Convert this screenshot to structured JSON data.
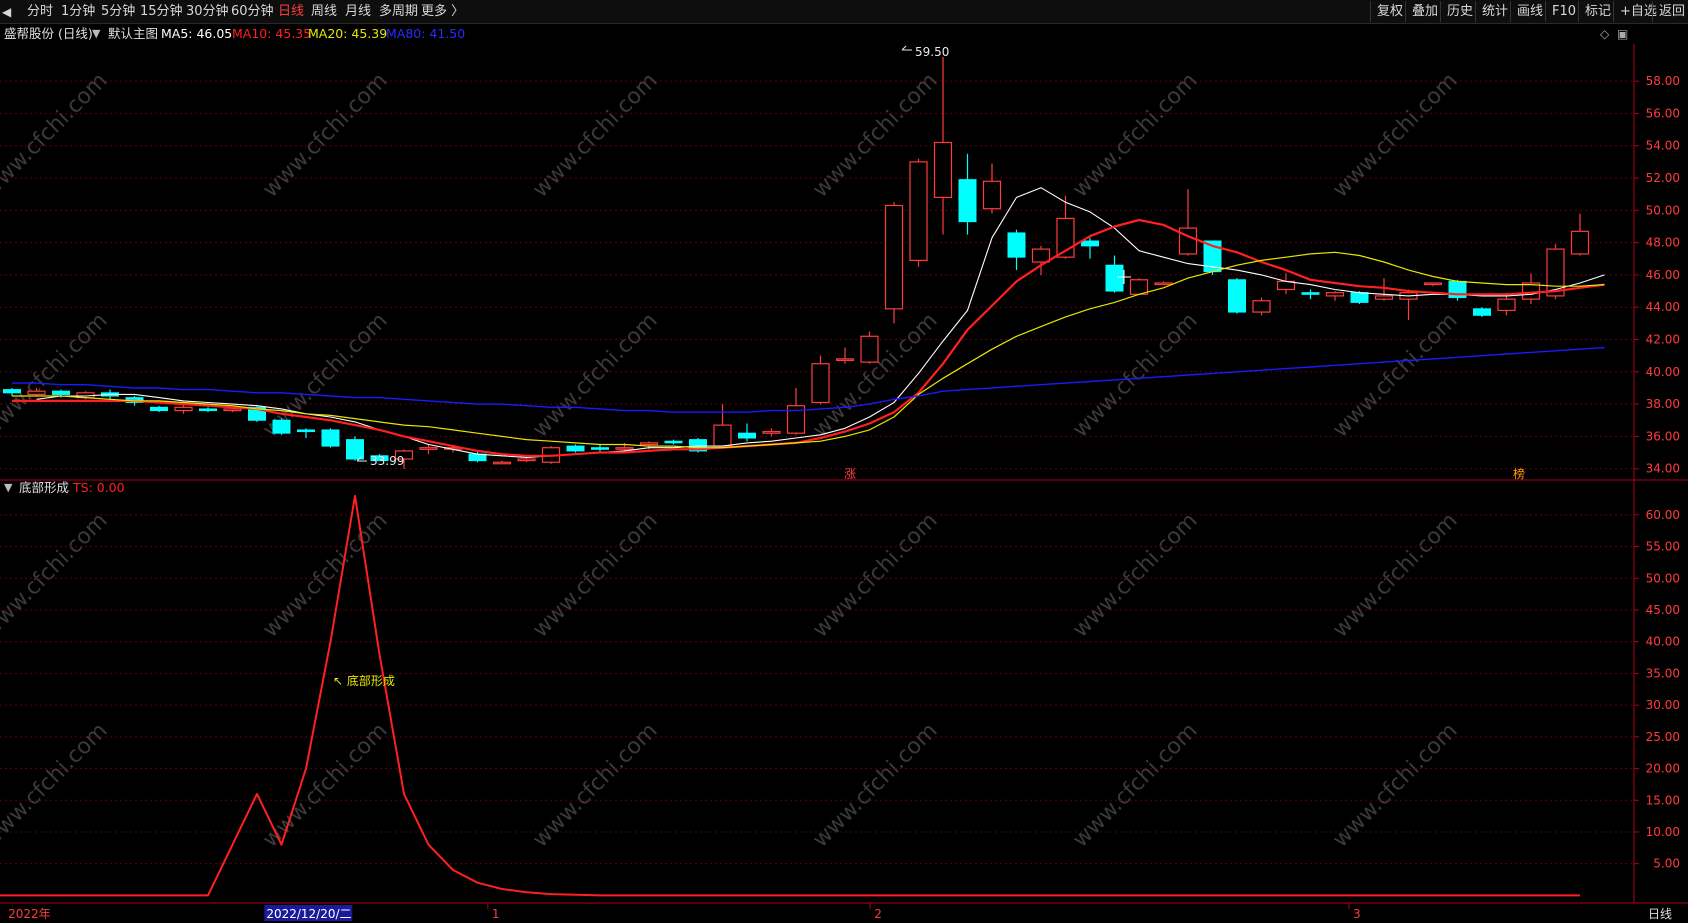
{
  "toolbar": {
    "menu_icon": "menu-icon",
    "periods": [
      "分时",
      "1分钟",
      "5分钟",
      "15分钟",
      "30分钟",
      "60分钟",
      "日线",
      "周线",
      "月线",
      "多周期",
      "更多 〉"
    ],
    "active_period": "日线",
    "right_buttons": [
      "复权",
      "叠加",
      "历史",
      "统计",
      "画线",
      "F10",
      "标记",
      "+自选",
      "返回"
    ]
  },
  "main_header": {
    "stock": "盛帮股份 (日线)",
    "indicator_name": "默认主图",
    "ma5": "MA5: 46.05",
    "ma10": "MA10: 45.35",
    "ma20": "MA20: 45.39",
    "ma80": "MA80: 41.50"
  },
  "sub_header": {
    "indicator": "底部形成",
    "ts": "TS: 0.00"
  },
  "annotations": {
    "high_label": "59.50",
    "low_label": "33.99",
    "zhang_marker": "涨",
    "bang_marker": "榜",
    "bottom_label": "↖ 底部形成"
  },
  "x_axis": {
    "labels": [
      {
        "text": "2022年",
        "pos": 0.005
      },
      {
        "text": "2022/12/20/二",
        "pos": 0.163
      },
      {
        "text": "1",
        "pos": 0.301
      },
      {
        "text": "2",
        "pos": 0.535
      },
      {
        "text": "3",
        "pos": 0.828
      }
    ],
    "period_label": "日线"
  },
  "watermark": "www.cfchi.com",
  "colors": {
    "up": "#ff3c3c",
    "down": "#00ffff",
    "ma5": "#ffffff",
    "ma10": "#ff2020",
    "ma20": "#e6e600",
    "ma80": "#1a1aff",
    "indicator": "#ff2020",
    "active_period": "#ff3c3c"
  },
  "chart_data": [
    {
      "type": "candlestick",
      "title": "盛帮股份 (日线)",
      "y_ticks": [
        34,
        36,
        38,
        40,
        42,
        44,
        46,
        48,
        50,
        52,
        54,
        56,
        58
      ],
      "ylim": [
        33.3,
        60.3
      ],
      "candles": [
        [
          38.9,
          38.7,
          39.0,
          38.5
        ],
        [
          38.6,
          38.8,
          39.0,
          38.5
        ],
        [
          38.8,
          38.6,
          38.9,
          38.4
        ],
        [
          38.4,
          38.7,
          38.8,
          38.3
        ],
        [
          38.7,
          38.5,
          38.9,
          38.2
        ],
        [
          38.4,
          38.1,
          38.5,
          37.9
        ],
        [
          37.8,
          37.6,
          37.9,
          37.5
        ],
        [
          37.6,
          37.8,
          38.0,
          37.4
        ],
        [
          37.7,
          37.6,
          37.8,
          37.5
        ],
        [
          37.6,
          37.7,
          37.8,
          37.5
        ],
        [
          37.8,
          37.0,
          37.9,
          36.9
        ],
        [
          37.0,
          36.2,
          37.1,
          36.1
        ],
        [
          36.4,
          36.3,
          36.5,
          35.9
        ],
        [
          36.4,
          35.4,
          36.5,
          35.3
        ],
        [
          35.8,
          34.6,
          36.0,
          34.5
        ],
        [
          34.8,
          34.5,
          34.9,
          34.5
        ],
        [
          34.6,
          35.1,
          35.2,
          33.99
        ],
        [
          35.2,
          35.3,
          35.5,
          34.9
        ],
        [
          35.3,
          35.3,
          35.4,
          35.0
        ],
        [
          34.9,
          34.5,
          35.1,
          34.4
        ],
        [
          34.4,
          34.4,
          34.5,
          34.3
        ],
        [
          34.5,
          34.6,
          34.7,
          34.4
        ],
        [
          34.4,
          35.3,
          35.4,
          34.3
        ],
        [
          35.4,
          35.1,
          35.5,
          35.0
        ],
        [
          35.3,
          35.2,
          35.5,
          35.0
        ],
        [
          35.3,
          35.3,
          35.6,
          35.1
        ],
        [
          35.5,
          35.6,
          35.7,
          35.2
        ],
        [
          35.7,
          35.6,
          35.8,
          35.5
        ],
        [
          35.8,
          35.1,
          35.9,
          35.0
        ],
        [
          35.4,
          36.7,
          38.0,
          35.3
        ],
        [
          36.2,
          35.9,
          36.8,
          35.7
        ],
        [
          36.2,
          36.3,
          36.5,
          36.0
        ],
        [
          36.2,
          37.9,
          39.0,
          36.1
        ],
        [
          38.1,
          40.5,
          41.0,
          38.0
        ],
        [
          40.8,
          40.8,
          41.5,
          40.5
        ],
        [
          40.6,
          42.2,
          42.5,
          40.5
        ],
        [
          43.9,
          50.3,
          50.5,
          43.0
        ],
        [
          46.9,
          53.0,
          53.2,
          46.5
        ],
        [
          50.8,
          54.2,
          59.5,
          48.5
        ],
        [
          51.9,
          49.3,
          53.5,
          48.5
        ],
        [
          50.1,
          51.8,
          52.9,
          49.8
        ],
        [
          48.6,
          47.1,
          48.8,
          46.3
        ],
        [
          46.8,
          47.6,
          47.8,
          46.0
        ],
        [
          47.1,
          49.5,
          50.9,
          47.0
        ],
        [
          48.1,
          47.8,
          48.3,
          47.0
        ],
        [
          46.6,
          45.0,
          47.2,
          44.9
        ],
        [
          44.8,
          45.7,
          45.8,
          44.8
        ],
        [
          45.5,
          45.5,
          45.6,
          45.4
        ],
        [
          47.3,
          48.9,
          51.3,
          47.2
        ],
        [
          48.1,
          46.2,
          48.1,
          46.0
        ],
        [
          45.7,
          43.7,
          45.8,
          43.6
        ],
        [
          43.7,
          44.4,
          44.6,
          43.5
        ],
        [
          45.1,
          45.6,
          46.1,
          44.8
        ],
        [
          44.9,
          44.8,
          45.1,
          44.5
        ],
        [
          44.7,
          44.9,
          45.0,
          44.4
        ],
        [
          44.9,
          44.3,
          45.0,
          44.2
        ],
        [
          44.5,
          44.7,
          45.8,
          44.4
        ],
        [
          44.5,
          44.9,
          45.1,
          43.2
        ],
        [
          45.5,
          45.5,
          45.5,
          45.3
        ],
        [
          45.6,
          44.6,
          45.7,
          44.4
        ],
        [
          43.9,
          43.5,
          44.0,
          43.4
        ],
        [
          43.8,
          44.5,
          44.9,
          43.5
        ],
        [
          44.5,
          45.5,
          46.1,
          44.2
        ],
        [
          44.7,
          47.6,
          47.9,
          44.5
        ],
        [
          47.3,
          48.7,
          49.8,
          47.2
        ]
      ],
      "series": [
        {
          "name": "MA5",
          "start": 1,
          "values": [
            38.3,
            38.5,
            38.5,
            38.6,
            38.6,
            38.4,
            38.2,
            38.1,
            38.0,
            37.9,
            37.7,
            37.4,
            37.2,
            36.9,
            36.4,
            36.0,
            35.5,
            35.2,
            34.9,
            34.8,
            34.7,
            34.8,
            34.9,
            35.0,
            35.1,
            35.3,
            35.3,
            35.4,
            35.4,
            35.6,
            35.7,
            35.9,
            36.1,
            36.5,
            37.2,
            38.1,
            39.9,
            41.9,
            43.8,
            48.3,
            50.8,
            51.4,
            50.5,
            49.9,
            48.9,
            47.5,
            47.1,
            46.7,
            46.5,
            46.3,
            46.0,
            45.6,
            45.4,
            45.1,
            44.9,
            44.8,
            44.7,
            44.8,
            44.8,
            44.7,
            44.7,
            44.8,
            45.1,
            45.5,
            46.0
          ]
        },
        {
          "name": "MA10",
          "start": 0,
          "values": [
            38.2,
            38.2,
            38.2,
            38.2,
            38.2,
            38.2,
            38.1,
            38.0,
            37.9,
            37.8,
            37.7,
            37.4,
            37.2,
            37.0,
            36.7,
            36.4,
            36.0,
            35.7,
            35.4,
            35.1,
            34.9,
            34.8,
            34.8,
            34.9,
            35.0,
            35.0,
            35.1,
            35.2,
            35.2,
            35.3,
            35.4,
            35.5,
            35.6,
            35.9,
            36.3,
            36.8,
            37.5,
            38.7,
            40.5,
            42.6,
            44.1,
            45.6,
            46.6,
            47.5,
            48.4,
            49.0,
            49.4,
            49.1,
            48.4,
            47.8,
            47.4,
            46.8,
            46.3,
            45.7,
            45.5,
            45.3,
            45.2,
            45.0,
            44.9,
            44.8,
            44.8,
            44.8,
            44.9,
            45.0,
            45.2,
            45.4
          ]
        },
        {
          "name": "MA20",
          "start": 0,
          "values": [
            38.5,
            38.5,
            38.5,
            38.4,
            38.3,
            38.2,
            38.2,
            38.1,
            38.0,
            37.9,
            37.7,
            37.6,
            37.4,
            37.3,
            37.1,
            36.9,
            36.7,
            36.6,
            36.4,
            36.2,
            36.0,
            35.8,
            35.7,
            35.6,
            35.5,
            35.5,
            35.4,
            35.4,
            35.3,
            35.3,
            35.4,
            35.5,
            35.6,
            35.7,
            36.0,
            36.4,
            37.2,
            38.6,
            39.6,
            40.5,
            41.4,
            42.2,
            42.8,
            43.4,
            43.9,
            44.3,
            44.8,
            45.2,
            45.8,
            46.2,
            46.6,
            46.9,
            47.1,
            47.3,
            47.4,
            47.2,
            46.8,
            46.3,
            45.9,
            45.6,
            45.5,
            45.4,
            45.4,
            45.3,
            45.3,
            45.4
          ]
        },
        {
          "name": "MA80",
          "start": 0,
          "values": [
            39.3,
            39.3,
            39.2,
            39.2,
            39.1,
            39.0,
            39.0,
            38.9,
            38.9,
            38.8,
            38.7,
            38.7,
            38.6,
            38.5,
            38.4,
            38.4,
            38.3,
            38.2,
            38.1,
            38.0,
            38.0,
            37.9,
            37.8,
            37.8,
            37.7,
            37.6,
            37.6,
            37.5,
            37.5,
            37.5,
            37.5,
            37.6,
            37.6,
            37.7,
            37.8,
            38.0,
            38.3,
            38.5,
            38.8,
            38.9,
            39.0,
            39.1,
            39.2,
            39.3,
            39.4,
            39.5,
            39.6,
            39.7,
            39.8,
            39.9,
            40.0,
            40.1,
            40.2,
            40.3,
            40.4,
            40.5,
            40.6,
            40.7,
            40.8,
            40.9,
            41.0,
            41.1,
            41.2,
            41.3,
            41.4,
            41.5
          ]
        }
      ]
    },
    {
      "type": "line",
      "title": "底部形成",
      "y_ticks": [
        5,
        10,
        15,
        20,
        25,
        30,
        35,
        40,
        45,
        50,
        55,
        60
      ],
      "ylim": [
        -1.2,
        65.5
      ],
      "series": [
        {
          "name": "TS",
          "color": "#ff2020",
          "values": [
            0,
            0,
            0,
            0,
            0,
            0,
            0,
            0,
            0,
            8,
            16,
            8,
            20,
            40,
            63,
            38,
            16,
            8,
            4,
            2,
            1,
            0.5,
            0.2,
            0.1,
            0,
            0,
            0,
            0,
            0,
            0,
            0,
            0,
            0,
            0,
            0,
            0,
            0,
            0,
            0,
            0,
            0,
            0,
            0,
            0,
            0,
            0,
            0,
            0,
            0,
            0,
            0,
            0,
            0,
            0,
            0,
            0,
            0,
            0,
            0,
            0,
            0,
            0,
            0,
            0,
            0
          ]
        }
      ]
    }
  ]
}
